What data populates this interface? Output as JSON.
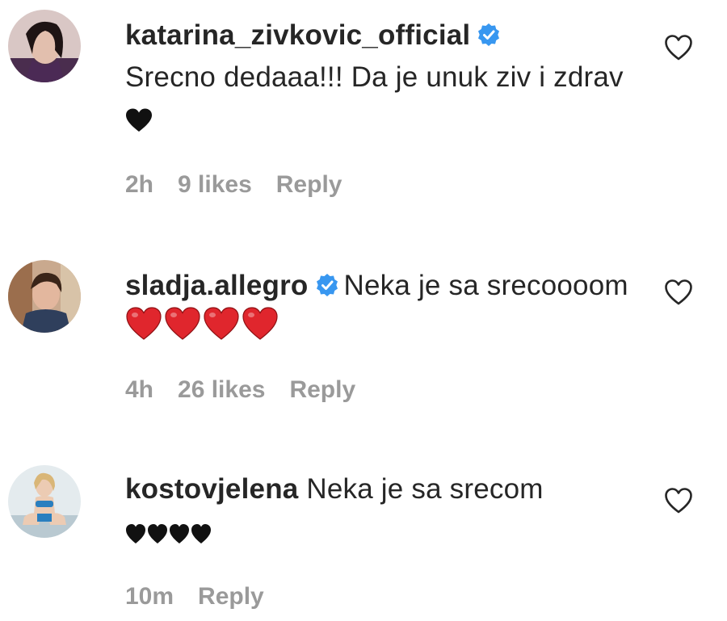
{
  "comments": [
    {
      "username": "katarina_zivkovic_official",
      "text": "Srecno dedaaa!!! Da je unuk ziv i zdrav",
      "emoji": "black-heart",
      "time": "2h",
      "likes": "9 likes",
      "reply": "Reply"
    },
    {
      "username": "sladja.allegro",
      "text": "Neka je sa srecoooom",
      "emoji": "red-heart x4",
      "time": "4h",
      "likes": "26 likes",
      "reply": "Reply"
    },
    {
      "username": "kostovjelena",
      "text": "Neka je sa srecom",
      "emoji": "black-heart x4",
      "time": "10m",
      "reply": "Reply"
    }
  ],
  "colors": {
    "verified": "#3897f0",
    "meta": "#9a9a9a",
    "text": "#262626",
    "red_heart": "#e0262d"
  }
}
